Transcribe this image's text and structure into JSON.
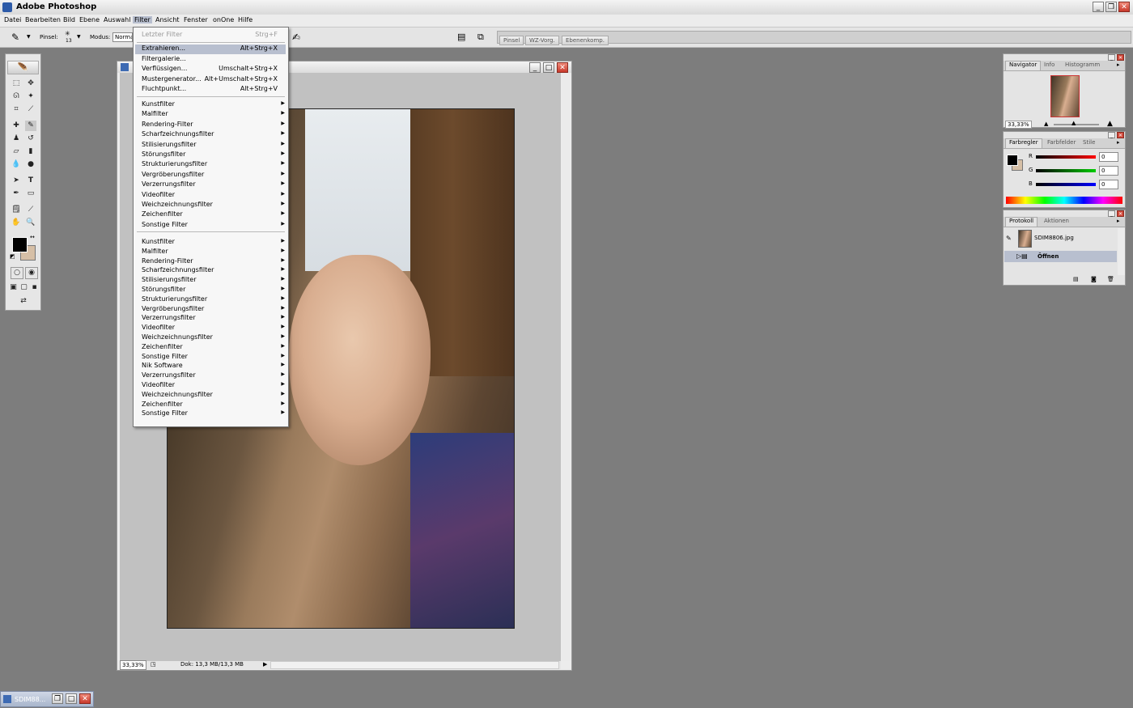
{
  "app": {
    "title": "Adobe Photoshop"
  },
  "menubar": [
    "Datei",
    "Bearbeiten",
    "Bild",
    "Ebene",
    "Auswahl",
    "Filter",
    "Ansicht",
    "Fenster",
    "onOne",
    "Hilfe"
  ],
  "options": {
    "brush_label": "Pinsel:",
    "brush_size": "13",
    "mode_label": "Modus:",
    "mode_value": "Normal"
  },
  "palette_well": [
    "Pinsel",
    "WZ-Vorg.",
    "Ebenenkomp."
  ],
  "filter_menu": {
    "last_filter": {
      "label": "Letzter Filter",
      "shortcut": "Strg+F"
    },
    "top": [
      {
        "label": "Extrahieren...",
        "shortcut": "Alt+Strg+X"
      },
      {
        "label": "Filtergalerie...",
        "shortcut": ""
      },
      {
        "label": "Verflüssigen...",
        "shortcut": "Umschalt+Strg+X"
      },
      {
        "label": "Mustergenerator...",
        "shortcut": "Alt+Umschalt+Strg+X"
      },
      {
        "label": "Fluchtpunkt...",
        "shortcut": "Alt+Strg+V"
      }
    ],
    "group1": [
      "Kunstfilter",
      "Malfilter",
      "Rendering-Filter",
      "Scharfzeichnungsfilter",
      "Stilisierungsfilter",
      "Störungsfilter",
      "Strukturierungsfilter",
      "Vergröberungsfilter",
      "Verzerrungsfilter",
      "Videofilter",
      "Weichzeichnungsfilter",
      "Zeichenfilter",
      "Sonstige Filter"
    ],
    "group2": [
      "Kunstfilter",
      "Malfilter",
      "Rendering-Filter",
      "Scharfzeichnungsfilter",
      "Stilisierungsfilter",
      "Störungsfilter",
      "Strukturierungsfilter",
      "Vergröberungsfilter",
      "Verzerrungsfilter",
      "Videofilter",
      "Weichzeichnungsfilter",
      "Zeichenfilter",
      "Sonstige Filter",
      "Nik Software",
      "Verzerrungsfilter",
      "Videofilter",
      "Weichzeichnungsfilter",
      "Zeichenfilter",
      "Sonstige Filter"
    ]
  },
  "document": {
    "zoom": "33,33%",
    "status": "Dok: 13,3 MB/13,3 MB"
  },
  "navigator": {
    "tabs": [
      "Navigator",
      "Info",
      "Histogramm"
    ],
    "zoom": "33,33%"
  },
  "color_panel": {
    "tabs": [
      "Farbregler",
      "Farbfelder",
      "Stile"
    ],
    "r_label": "R",
    "g_label": "G",
    "b_label": "B",
    "r": "0",
    "g": "0",
    "b": "0"
  },
  "history_panel": {
    "tabs": [
      "Protokoll",
      "Aktionen"
    ],
    "snapshot": "SDIM8806.jpg",
    "step": "Öffnen"
  },
  "minimized_doc": {
    "label": "SDIM88..."
  },
  "colors": {
    "accent": "#b8bfcf",
    "workspace": "#7d7d7d"
  }
}
